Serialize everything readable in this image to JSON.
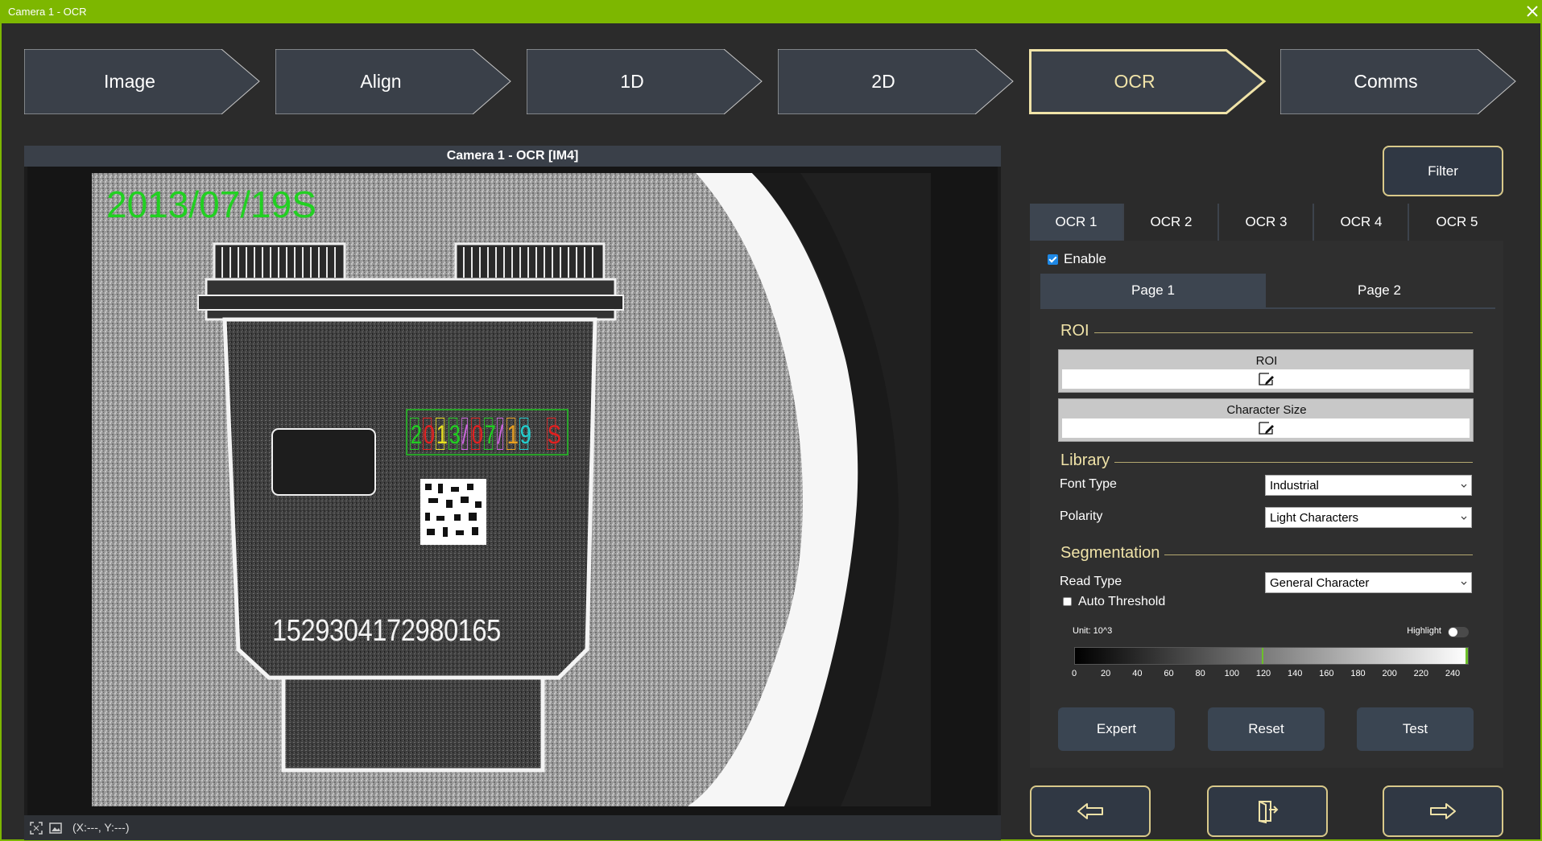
{
  "window": {
    "title": "Camera 1 - OCR"
  },
  "steps": [
    {
      "label": "Image",
      "active": false
    },
    {
      "label": "Align",
      "active": false
    },
    {
      "label": "1D",
      "active": false
    },
    {
      "label": "2D",
      "active": false
    },
    {
      "label": "OCR",
      "active": true
    },
    {
      "label": "Comms",
      "active": false
    }
  ],
  "viewer": {
    "header": "Camera 1 - OCR  [IM4]",
    "overlay_text": "2013/07/19S",
    "serial_text": "1529304172980165",
    "ocr_chars": [
      "2",
      "0",
      "1",
      "3",
      "/",
      "0",
      "7",
      "/",
      "1",
      "9",
      "S"
    ],
    "coords": "(X:---, Y:---)"
  },
  "panel": {
    "filter_label": "Filter",
    "ocr_tabs": [
      "OCR 1",
      "OCR 2",
      "OCR 3",
      "OCR 4",
      "OCR 5"
    ],
    "enable_label": "Enable",
    "enable_checked": true,
    "page_tabs": [
      "Page 1",
      "Page 2"
    ],
    "roi": {
      "title": "ROI",
      "roi_label": "ROI",
      "char_size_label": "Character Size"
    },
    "library": {
      "title": "Library",
      "font_type_label": "Font Type",
      "font_type_value": "Industrial",
      "polarity_label": "Polarity",
      "polarity_value": "Light Characters"
    },
    "segmentation": {
      "title": "Segmentation",
      "read_type_label": "Read Type",
      "read_type_value": "General Character",
      "auto_threshold_label": "Auto Threshold",
      "auto_threshold_checked": false,
      "unit_label": "Unit: 10^3",
      "highlight_label": "Highlight",
      "axis_ticks": [
        "0",
        "20",
        "40",
        "60",
        "80",
        "100",
        "120",
        "140",
        "160",
        "180",
        "200",
        "220",
        "240"
      ]
    },
    "buttons": {
      "expert": "Expert",
      "reset": "Reset",
      "test": "Test"
    }
  },
  "colors": {
    "accent": "#7db700",
    "highlight": "#f0e3a8",
    "panel": "#3d4550"
  }
}
